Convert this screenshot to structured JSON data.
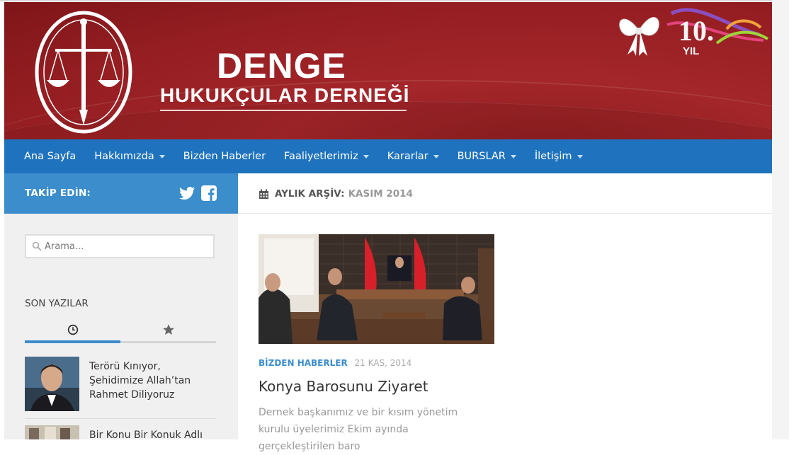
{
  "brand": {
    "title": "DENGE",
    "subtitle": "HUKUKÇULAR DERNEĞİ",
    "anniversary": "10.",
    "anniversary_unit": "YIL"
  },
  "nav": {
    "items": [
      {
        "label": "Ana Sayfa",
        "dropdown": false
      },
      {
        "label": "Hakkımızda",
        "dropdown": true
      },
      {
        "label": "Bizden Haberler",
        "dropdown": false
      },
      {
        "label": "Faaliyetlerimiz",
        "dropdown": true
      },
      {
        "label": "Kararlar",
        "dropdown": true
      },
      {
        "label": "BURSLAR",
        "dropdown": true
      },
      {
        "label": "İletişim",
        "dropdown": true
      }
    ]
  },
  "sidebar": {
    "follow_label": "TAKİP EDİN:",
    "social_icons": [
      "twitter-icon",
      "facebook-icon"
    ],
    "search_placeholder": "Arama...",
    "recent_heading": "SON YAZILAR",
    "tabs": [
      "clock-icon",
      "star-icon"
    ],
    "posts": [
      {
        "title": "Terörü Kınıyor, Şehidimize Allah’tan Rahmet Diliyoruz"
      },
      {
        "title": "Bir Konu Bir Konuk Adlı"
      }
    ]
  },
  "main": {
    "archive_prefix": "AYLIK ARŞİV:",
    "archive_value": "KASIM 2014",
    "post": {
      "category": "BİZDEN HABERLER",
      "date": "21 KAS, 2014",
      "title": "Konya Barosunu Ziyaret",
      "excerpt": "Dernek başkanımız ve bir kısım yönetim kurulu üyelerimiz Ekim ayında gerçekleştirilen baro"
    }
  },
  "colors": {
    "header_red": "#a3262a",
    "nav_blue": "#1f73be",
    "accent_blue": "#3b8dcc"
  }
}
